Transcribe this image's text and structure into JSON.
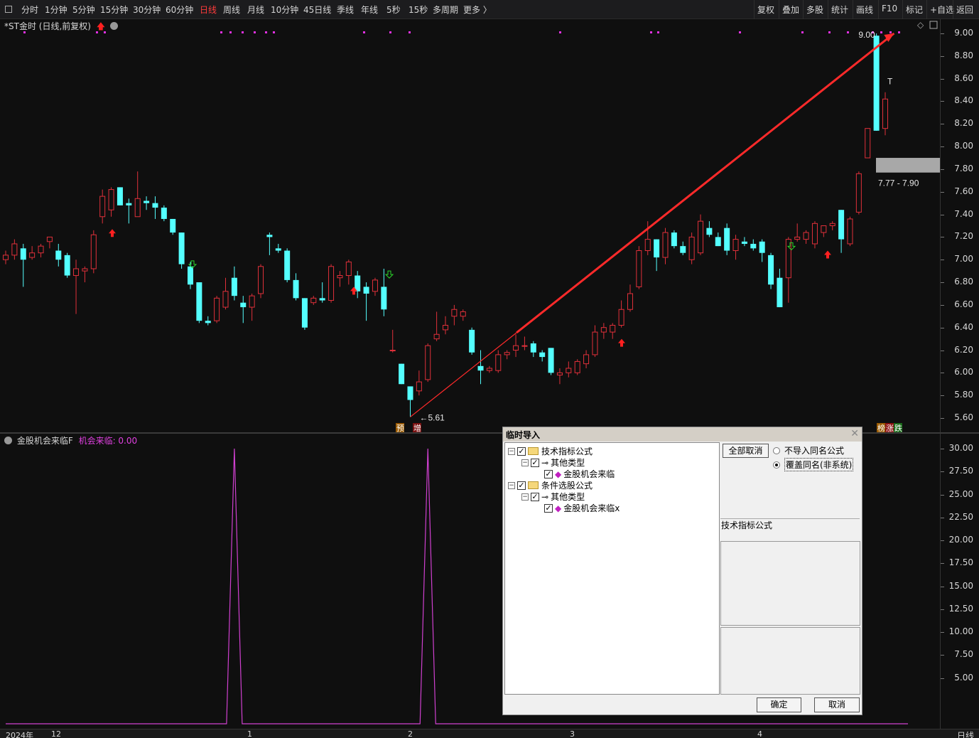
{
  "toolbar": {
    "left_items": [
      "分时",
      "1分钟",
      "5分钟",
      "15分钟",
      "30分钟",
      "60分钟",
      "日线",
      "周线",
      "月线",
      "10分钟",
      "45日线",
      "季线",
      "年线",
      "5秒",
      "15秒",
      "多周期",
      "更多 〉"
    ],
    "active_item": "日线",
    "right_items": [
      "复权",
      "叠加",
      "多股",
      "统计",
      "画线",
      "F10",
      "标记",
      "+自选",
      "返回"
    ]
  },
  "chart_title": "*ST金时 (日线,前复权)",
  "price_axis": [
    "9.00",
    "8.80",
    "8.60",
    "8.40",
    "8.20",
    "8.00",
    "7.80",
    "7.60",
    "7.40",
    "7.20",
    "7.00",
    "6.80",
    "6.60",
    "6.40",
    "6.20",
    "6.00",
    "5.80",
    "5.60"
  ],
  "price_annotations": {
    "high": "9.00",
    "low": "5.61",
    "range": "7.77 - 7.90",
    "marker_t": "T"
  },
  "price_badges": {
    "yu": "预",
    "zeng": "增",
    "bang": "榜",
    "zhang": "涨",
    "die": "跌"
  },
  "indicator": {
    "name": "金股机会来临F",
    "line_label": "机会来临: 0.00"
  },
  "indicator_axis": [
    "30.00",
    "27.50",
    "25.00",
    "22.50",
    "20.00",
    "17.50",
    "15.00",
    "12.50",
    "10.00",
    "7.50",
    "5.00"
  ],
  "date_axis": {
    "year": "2024年",
    "labels": [
      "12",
      "1",
      "2",
      "3",
      "4"
    ],
    "period": "日线"
  },
  "dialog": {
    "title": "临时导入",
    "tree": [
      {
        "label": "技术指标公式",
        "level": 0
      },
      {
        "label": "其他类型",
        "level": 1
      },
      {
        "label": "金股机会来临",
        "level": 2
      },
      {
        "label": "条件选股公式",
        "level": 0
      },
      {
        "label": "其他类型",
        "level": 1
      },
      {
        "label": "金股机会来临x",
        "level": 2
      }
    ],
    "cancel_all": "全部取消",
    "radio1": "不导入同名公式",
    "radio2": "覆盖同名(非系统)",
    "section_label": "技术指标公式",
    "ok": "确定",
    "cancel": "取消"
  },
  "chart_data": [
    {
      "type": "candlestick",
      "title": "*ST金时 (日线,前复权)",
      "ylim": [
        5.55,
        9.05
      ],
      "candles": [
        {
          "o": 7.0,
          "h": 7.08,
          "l": 6.96,
          "c": 7.04
        },
        {
          "o": 7.04,
          "h": 7.18,
          "l": 7.0,
          "c": 7.14
        },
        {
          "o": 7.1,
          "h": 7.14,
          "l": 6.76,
          "c": 7.0
        },
        {
          "o": 7.02,
          "h": 7.12,
          "l": 7.0,
          "c": 7.06
        },
        {
          "o": 7.06,
          "h": 7.14,
          "l": 7.02,
          "c": 7.12
        },
        {
          "o": 7.16,
          "h": 7.2,
          "l": 7.1,
          "c": 7.2
        },
        {
          "o": 7.08,
          "h": 7.14,
          "l": 6.94,
          "c": 7.0
        },
        {
          "o": 7.04,
          "h": 7.06,
          "l": 6.84,
          "c": 6.86
        },
        {
          "o": 6.86,
          "h": 7.0,
          "l": 6.52,
          "c": 6.92
        },
        {
          "o": 6.9,
          "h": 6.94,
          "l": 6.8,
          "c": 6.92
        },
        {
          "o": 6.92,
          "h": 7.26,
          "l": 6.88,
          "c": 7.22
        },
        {
          "o": 7.38,
          "h": 7.62,
          "l": 7.32,
          "c": 7.56
        },
        {
          "o": 7.44,
          "h": 7.64,
          "l": 7.38,
          "c": 7.62
        },
        {
          "o": 7.64,
          "h": 7.64,
          "l": 7.48,
          "c": 7.48
        },
        {
          "o": 7.5,
          "h": 7.54,
          "l": 7.32,
          "c": 7.48
        },
        {
          "o": 7.38,
          "h": 7.78,
          "l": 7.38,
          "c": 7.54
        },
        {
          "o": 7.52,
          "h": 7.56,
          "l": 7.44,
          "c": 7.5
        },
        {
          "o": 7.5,
          "h": 7.56,
          "l": 7.36,
          "c": 7.46
        },
        {
          "o": 7.46,
          "h": 7.48,
          "l": 7.34,
          "c": 7.36
        },
        {
          "o": 7.36,
          "h": 7.36,
          "l": 7.22,
          "c": 7.24
        },
        {
          "o": 7.24,
          "h": 7.24,
          "l": 6.92,
          "c": 6.96
        },
        {
          "o": 6.94,
          "h": 6.98,
          "l": 6.74,
          "c": 6.78
        },
        {
          "o": 6.8,
          "h": 6.8,
          "l": 6.44,
          "c": 6.46
        },
        {
          "o": 6.46,
          "h": 6.5,
          "l": 6.42,
          "c": 6.44
        },
        {
          "o": 6.46,
          "h": 6.68,
          "l": 6.44,
          "c": 6.66
        },
        {
          "o": 6.58,
          "h": 6.84,
          "l": 6.56,
          "c": 6.72
        },
        {
          "o": 6.84,
          "h": 6.94,
          "l": 6.64,
          "c": 6.68
        },
        {
          "o": 6.62,
          "h": 6.68,
          "l": 6.44,
          "c": 6.58
        },
        {
          "o": 6.58,
          "h": 6.7,
          "l": 6.46,
          "c": 6.68
        },
        {
          "o": 6.7,
          "h": 6.96,
          "l": 6.66,
          "c": 6.94
        },
        {
          "o": 7.22,
          "h": 7.24,
          "l": 7.04,
          "c": 7.2
        },
        {
          "o": 7.1,
          "h": 7.14,
          "l": 7.06,
          "c": 7.08
        },
        {
          "o": 7.08,
          "h": 7.1,
          "l": 6.8,
          "c": 6.82
        },
        {
          "o": 6.82,
          "h": 6.88,
          "l": 6.64,
          "c": 6.66
        },
        {
          "o": 6.66,
          "h": 6.66,
          "l": 6.38,
          "c": 6.4
        },
        {
          "o": 6.62,
          "h": 6.68,
          "l": 6.6,
          "c": 6.66
        },
        {
          "o": 6.66,
          "h": 6.8,
          "l": 6.62,
          "c": 6.64
        },
        {
          "o": 6.64,
          "h": 6.96,
          "l": 6.62,
          "c": 6.94
        },
        {
          "o": 6.84,
          "h": 6.9,
          "l": 6.76,
          "c": 6.86
        },
        {
          "o": 6.86,
          "h": 7.0,
          "l": 6.78,
          "c": 6.98
        },
        {
          "o": 6.86,
          "h": 6.9,
          "l": 6.66,
          "c": 6.72
        },
        {
          "o": 6.76,
          "h": 6.8,
          "l": 6.46,
          "c": 6.7
        },
        {
          "o": 6.72,
          "h": 6.84,
          "l": 6.68,
          "c": 6.82
        },
        {
          "o": 6.76,
          "h": 6.92,
          "l": 6.5,
          "c": 6.56
        },
        {
          "o": 6.2,
          "h": 6.38,
          "l": 6.18,
          "c": 6.2
        },
        {
          "o": 6.08,
          "h": 6.08,
          "l": 5.9,
          "c": 5.9
        },
        {
          "o": 5.88,
          "h": 5.88,
          "l": 5.61,
          "c": 5.76
        },
        {
          "o": 5.84,
          "h": 6.02,
          "l": 5.8,
          "c": 5.92
        },
        {
          "o": 5.94,
          "h": 6.26,
          "l": 5.92,
          "c": 6.24
        },
        {
          "o": 6.3,
          "h": 6.54,
          "l": 6.28,
          "c": 6.34
        },
        {
          "o": 6.38,
          "h": 6.5,
          "l": 6.34,
          "c": 6.42
        },
        {
          "o": 6.5,
          "h": 6.6,
          "l": 6.42,
          "c": 6.56
        },
        {
          "o": 6.5,
          "h": 6.56,
          "l": 6.46,
          "c": 6.54
        },
        {
          "o": 6.38,
          "h": 6.4,
          "l": 6.16,
          "c": 6.18
        },
        {
          "o": 6.06,
          "h": 6.2,
          "l": 5.9,
          "c": 6.02
        },
        {
          "o": 6.02,
          "h": 6.06,
          "l": 6.0,
          "c": 6.04
        },
        {
          "o": 6.02,
          "h": 6.2,
          "l": 6.0,
          "c": 6.16
        },
        {
          "o": 6.16,
          "h": 6.2,
          "l": 6.12,
          "c": 6.18
        },
        {
          "o": 6.2,
          "h": 6.34,
          "l": 6.14,
          "c": 6.24
        },
        {
          "o": 6.24,
          "h": 6.32,
          "l": 6.2,
          "c": 6.24
        },
        {
          "o": 6.26,
          "h": 6.28,
          "l": 6.14,
          "c": 6.18
        },
        {
          "o": 6.18,
          "h": 6.2,
          "l": 6.1,
          "c": 6.14
        },
        {
          "o": 6.22,
          "h": 6.22,
          "l": 5.98,
          "c": 6.0
        },
        {
          "o": 5.98,
          "h": 6.04,
          "l": 5.9,
          "c": 6.0
        },
        {
          "o": 6.0,
          "h": 6.1,
          "l": 5.96,
          "c": 6.04
        },
        {
          "o": 6.0,
          "h": 6.12,
          "l": 5.98,
          "c": 6.1
        },
        {
          "o": 6.08,
          "h": 6.2,
          "l": 6.04,
          "c": 6.16
        },
        {
          "o": 6.16,
          "h": 6.42,
          "l": 6.14,
          "c": 6.36
        },
        {
          "o": 6.36,
          "h": 6.44,
          "l": 6.3,
          "c": 6.4
        },
        {
          "o": 6.36,
          "h": 6.44,
          "l": 6.3,
          "c": 6.42
        },
        {
          "o": 6.42,
          "h": 6.64,
          "l": 6.4,
          "c": 6.56
        },
        {
          "o": 6.56,
          "h": 6.78,
          "l": 6.54,
          "c": 6.7
        },
        {
          "o": 6.76,
          "h": 7.12,
          "l": 6.74,
          "c": 7.08
        },
        {
          "o": 7.08,
          "h": 7.34,
          "l": 7.04,
          "c": 7.18
        },
        {
          "o": 7.18,
          "h": 7.18,
          "l": 6.9,
          "c": 7.02
        },
        {
          "o": 7.02,
          "h": 7.28,
          "l": 6.96,
          "c": 7.24
        },
        {
          "o": 7.24,
          "h": 7.26,
          "l": 7.1,
          "c": 7.12
        },
        {
          "o": 7.12,
          "h": 7.16,
          "l": 7.04,
          "c": 7.06
        },
        {
          "o": 7.0,
          "h": 7.24,
          "l": 6.96,
          "c": 7.2
        },
        {
          "o": 7.06,
          "h": 7.4,
          "l": 7.04,
          "c": 7.34
        },
        {
          "o": 7.28,
          "h": 7.34,
          "l": 7.2,
          "c": 7.22
        },
        {
          "o": 7.2,
          "h": 7.24,
          "l": 7.12,
          "c": 7.12
        },
        {
          "o": 7.28,
          "h": 7.32,
          "l": 7.04,
          "c": 7.08
        },
        {
          "o": 7.08,
          "h": 7.22,
          "l": 7.0,
          "c": 7.18
        },
        {
          "o": 7.16,
          "h": 7.2,
          "l": 7.12,
          "c": 7.14
        },
        {
          "o": 7.14,
          "h": 7.18,
          "l": 7.08,
          "c": 7.1
        },
        {
          "o": 7.16,
          "h": 7.18,
          "l": 6.98,
          "c": 7.06
        },
        {
          "o": 7.04,
          "h": 7.06,
          "l": 6.74,
          "c": 6.78
        },
        {
          "o": 6.84,
          "h": 6.92,
          "l": 6.58,
          "c": 6.58
        },
        {
          "o": 6.84,
          "h": 7.2,
          "l": 6.62,
          "c": 7.18
        },
        {
          "o": 7.18,
          "h": 7.32,
          "l": 7.16,
          "c": 7.2
        },
        {
          "o": 7.18,
          "h": 7.26,
          "l": 7.14,
          "c": 7.24
        },
        {
          "o": 7.14,
          "h": 7.34,
          "l": 7.1,
          "c": 7.32
        },
        {
          "o": 7.24,
          "h": 7.3,
          "l": 7.2,
          "c": 7.3
        },
        {
          "o": 7.3,
          "h": 7.34,
          "l": 7.26,
          "c": 7.32
        },
        {
          "o": 7.44,
          "h": 7.44,
          "l": 7.06,
          "c": 7.18
        },
        {
          "o": 7.14,
          "h": 7.38,
          "l": 7.12,
          "c": 7.36
        },
        {
          "o": 7.42,
          "h": 7.78,
          "l": 7.4,
          "c": 7.76
        },
        {
          "o": 7.9,
          "h": 8.16,
          "l": 7.9,
          "c": 8.16
        },
        {
          "o": 8.98,
          "h": 9.0,
          "l": 8.14,
          "c": 8.14
        },
        {
          "o": 8.16,
          "h": 8.48,
          "l": 8.1,
          "c": 8.42
        }
      ]
    },
    {
      "type": "line",
      "title": "金股机会来临F",
      "ylim": [
        0,
        30
      ],
      "series": [
        {
          "name": "机会来临",
          "values": [
            0,
            0,
            0,
            0,
            0,
            0,
            0,
            0,
            0,
            0,
            0,
            0,
            0,
            0,
            0,
            0,
            0,
            0,
            0,
            0,
            0,
            0,
            0,
            0,
            0,
            0,
            30,
            0,
            0,
            0,
            0,
            0,
            0,
            0,
            0,
            0,
            0,
            0,
            0,
            0,
            0,
            0,
            0,
            0,
            0,
            0,
            0,
            0,
            30,
            0,
            0,
            0,
            0,
            0,
            0,
            0,
            0,
            0,
            0,
            0,
            0,
            0,
            0,
            0,
            0,
            0,
            0,
            0,
            0,
            0,
            0,
            0,
            0,
            0,
            0,
            0,
            0,
            0,
            0,
            0,
            0,
            0,
            0,
            0,
            0,
            0,
            0,
            0,
            0,
            0,
            0,
            0,
            0,
            0,
            0,
            0,
            0,
            0,
            0,
            0,
            0,
            0,
            0
          ]
        }
      ]
    }
  ]
}
